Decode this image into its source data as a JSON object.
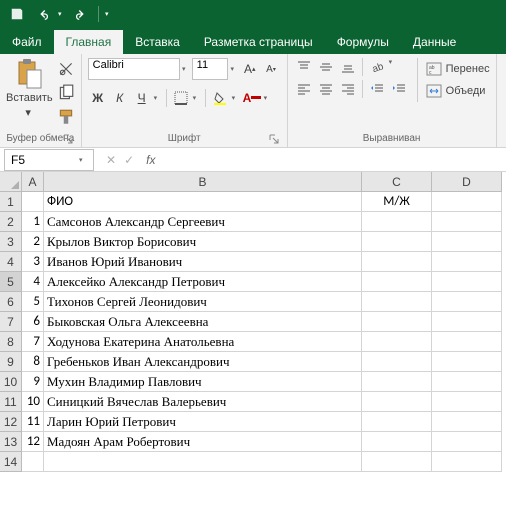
{
  "qat": {
    "save": "save",
    "undo": "undo",
    "redo": "redo"
  },
  "tabs": [
    "Файл",
    "Главная",
    "Вставка",
    "Разметка страницы",
    "Формулы",
    "Данные"
  ],
  "activeTab": 1,
  "clipboard": {
    "paste": "Вставить",
    "label": "Буфер обмена"
  },
  "font": {
    "name": "Calibri",
    "size": "11",
    "label": "Шрифт",
    "bold": "Ж",
    "italic": "К",
    "underline": "Ч"
  },
  "align": {
    "wrap": "Перенес",
    "merge": "Объеди",
    "label": "Выравниван"
  },
  "namebox": "F5",
  "formula": "",
  "cols": [
    "A",
    "B",
    "C",
    "D"
  ],
  "headers": {
    "b": "ФИО",
    "c": "М/Ж"
  },
  "rows": [
    {
      "n": "1",
      "b": "Самсонов Александр Сергеевич"
    },
    {
      "n": "2",
      "b": "Крылов Виктор Борисович"
    },
    {
      "n": "3",
      "b": "Иванов Юрий Иванович"
    },
    {
      "n": "4",
      "b": "Алексейко Александр Петрович"
    },
    {
      "n": "5",
      "b": "Тихонов Сергей Леонидович"
    },
    {
      "n": "6",
      "b": "Быковская Ольга Алексеевна"
    },
    {
      "n": "7",
      "b": "Ходунова Екатерина Анатольевна"
    },
    {
      "n": "8",
      "b": "Гребеньков Иван Александрович"
    },
    {
      "n": "9",
      "b": "Мухин Владимир Павлович"
    },
    {
      "n": "10",
      "b": "Синицкий Вячеслав Валерьевич"
    },
    {
      "n": "11",
      "b": "Ларин Юрий Петрович"
    },
    {
      "n": "12",
      "b": "Мадоян Арам Робертович"
    }
  ],
  "selectedRow": 5
}
